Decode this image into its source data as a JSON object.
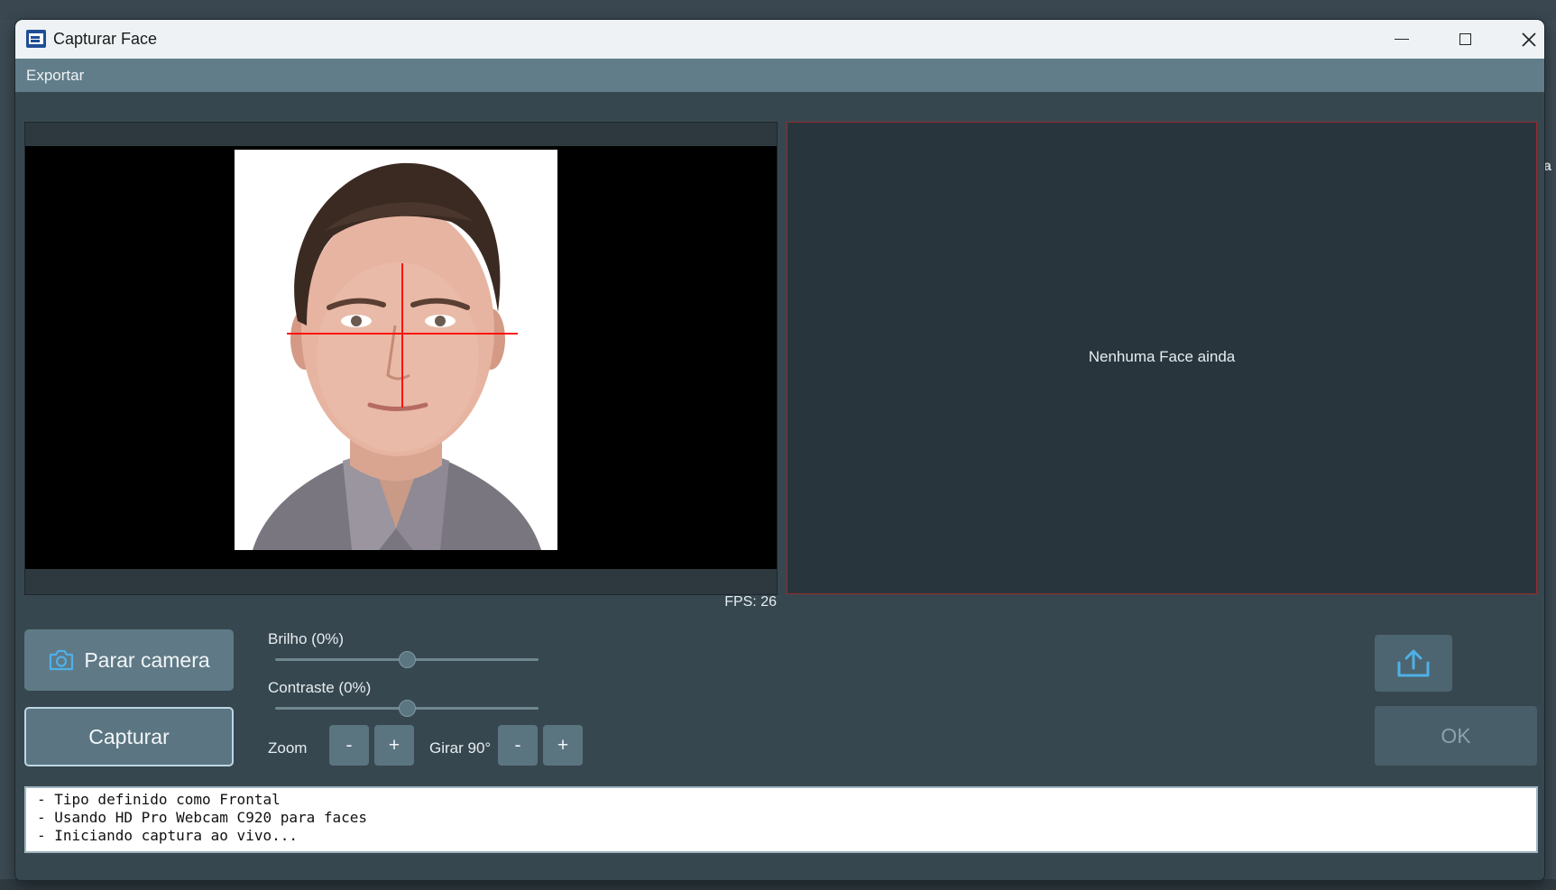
{
  "window": {
    "title": "Capturar Face"
  },
  "menu": {
    "items": [
      "Exportar"
    ]
  },
  "camera": {
    "fps_text": "FPS: 26"
  },
  "face_panel": {
    "empty_text": "Nenhuma Face ainda"
  },
  "controls": {
    "stop_camera_label": "Parar camera",
    "capture_label": "Capturar",
    "brightness": {
      "label": "Brilho (0%)",
      "value": 0,
      "position_fraction": 0.5
    },
    "contrast": {
      "label": "Contraste (0%)",
      "value": 0,
      "position_fraction": 0.5
    },
    "zoom_label": "Zoom",
    "rotate_label": "Girar 90°",
    "minus": "-",
    "plus": "+",
    "ok_label": "OK"
  },
  "log": {
    "lines": [
      "- Tipo definido como Frontal",
      "- Usando HD Pro Webcam C920 para faces",
      "- Iniciando captura ao vivo..."
    ]
  },
  "colors": {
    "crosshair": "#ff1111",
    "face_panel_border": "#9a2a2e",
    "menubar": "#617d89",
    "accent_icon": "#4fb0e8"
  }
}
